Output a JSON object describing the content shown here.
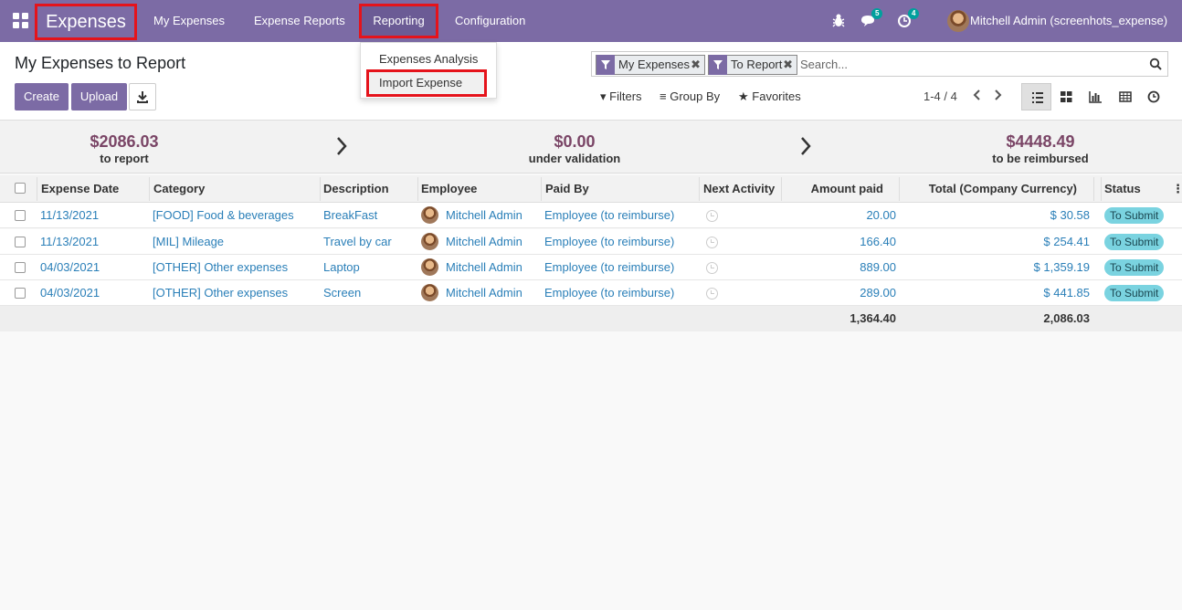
{
  "navbar": {
    "app_title": "Expenses",
    "menu": [
      "My Expenses",
      "Expense Reports",
      "Reporting",
      "Configuration"
    ],
    "messages_count": "5",
    "activities_count": "4",
    "user_name": "Mitchell Admin (screenhots_expense)"
  },
  "reporting_dropdown": {
    "items": [
      "Expenses Analysis",
      "Import Expense"
    ]
  },
  "control_panel": {
    "title": "My Expenses to Report",
    "create_label": "Create",
    "upload_label": "Upload",
    "facets": [
      "My Expenses",
      "To Report"
    ],
    "search_placeholder": "Search...",
    "filters_label": "Filters",
    "groupby_label": "Group By",
    "favorites_label": "Favorites",
    "pager": "1-4 / 4"
  },
  "stats": [
    {
      "value": "$2086.03",
      "label": "to report"
    },
    {
      "value": "$0.00",
      "label": "under validation"
    },
    {
      "value": "$4448.49",
      "label": "to be reimbursed"
    }
  ],
  "table": {
    "headers": [
      "Expense Date",
      "Category",
      "Description",
      "Employee",
      "Paid By",
      "Next Activity",
      "Amount paid",
      "Total (Company Currency)",
      "Status"
    ],
    "rows": [
      {
        "date": "11/13/2021",
        "category": "[FOOD] Food & beverages",
        "description": "BreakFast",
        "employee": "Mitchell Admin",
        "paid_by": "Employee (to reimburse)",
        "amount": "20.00",
        "total": "$ 30.58",
        "status": "To Submit"
      },
      {
        "date": "11/13/2021",
        "category": "[MIL] Mileage",
        "description": "Travel by car",
        "employee": "Mitchell Admin",
        "paid_by": "Employee (to reimburse)",
        "amount": "166.40",
        "total": "$ 254.41",
        "status": "To Submit"
      },
      {
        "date": "04/03/2021",
        "category": "[OTHER] Other expenses",
        "description": "Laptop",
        "employee": "Mitchell Admin",
        "paid_by": "Employee (to reimburse)",
        "amount": "889.00",
        "total": "$ 1,359.19",
        "status": "To Submit"
      },
      {
        "date": "04/03/2021",
        "category": "[OTHER] Other expenses",
        "description": "Screen",
        "employee": "Mitchell Admin",
        "paid_by": "Employee (to reimburse)",
        "amount": "289.00",
        "total": "$ 441.85",
        "status": "To Submit"
      }
    ],
    "totals": {
      "amount": "1,364.40",
      "total": "2,086.03"
    }
  },
  "colors": {
    "navbar": "#7c6ba5",
    "highlight_border": "#e5131b",
    "stat_value": "#7a4566",
    "link": "#2a7fb8",
    "status_badge": "#7ad3e0"
  }
}
